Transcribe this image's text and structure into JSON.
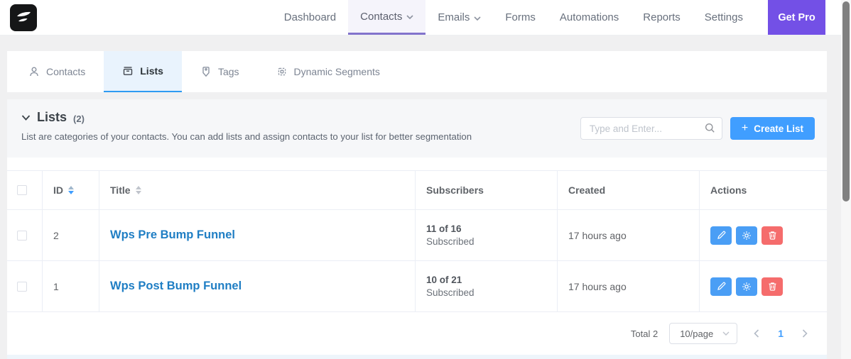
{
  "brand": {
    "logo_name": "fluentcrm-logo"
  },
  "nav": {
    "items": [
      {
        "label": "Dashboard"
      },
      {
        "label": "Contacts",
        "active": true,
        "has_dropdown": true
      },
      {
        "label": "Emails",
        "has_dropdown": true
      },
      {
        "label": "Forms"
      },
      {
        "label": "Automations"
      },
      {
        "label": "Reports"
      },
      {
        "label": "Settings"
      }
    ],
    "get_pro_label": "Get Pro"
  },
  "tabs": {
    "items": [
      {
        "label": "Contacts",
        "icon": "person-icon"
      },
      {
        "label": "Lists",
        "icon": "archive-icon",
        "active": true
      },
      {
        "label": "Tags",
        "icon": "tag-icon"
      },
      {
        "label": "Dynamic Segments",
        "icon": "chip-icon"
      }
    ]
  },
  "section": {
    "title": "Lists",
    "count": "(2)",
    "description": "List are categories of your contacts. You can add lists and assign contacts to your list for better segmentation",
    "search_placeholder": "Type and Enter...",
    "create_plus": "+",
    "create_label": "Create List"
  },
  "table": {
    "headers": {
      "id": "ID",
      "title": "Title",
      "subscribers": "Subscribers",
      "created": "Created",
      "actions": "Actions"
    },
    "sort": {
      "active_column": "ID",
      "direction": "desc"
    },
    "rows": [
      {
        "id": "2",
        "title": "Wps Pre Bump Funnel",
        "subscribers_count": "11 of 16",
        "subscribers_label": "Subscribed",
        "created": "17 hours ago"
      },
      {
        "id": "1",
        "title": "Wps Post Bump Funnel",
        "subscribers_count": "10 of 21",
        "subscribers_label": "Subscribed",
        "created": "17 hours ago"
      }
    ]
  },
  "pagination": {
    "total": "Total 2",
    "page_size": "10/page",
    "current_page": "1"
  },
  "colors": {
    "accent_purple": "#7350e6",
    "nav_active_underline": "#8273cc",
    "primary_blue": "#409eff",
    "tab_active_border": "#2f9bf2",
    "link_blue": "#1f7ec4",
    "danger_red": "#f56c6c"
  }
}
